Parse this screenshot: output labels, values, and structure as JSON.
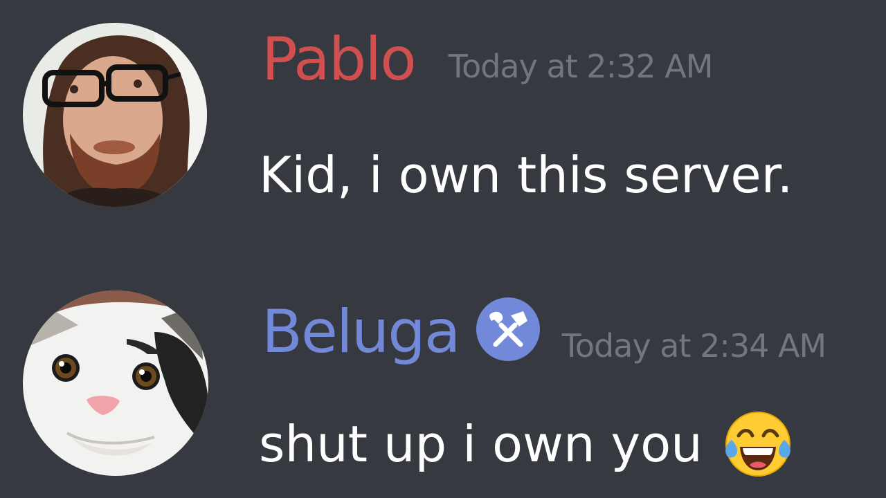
{
  "messages": [
    {
      "username": "Pablo",
      "timestamp": "Today at 2:32 AM",
      "text": "Kid, i own this server.",
      "username_color": "#d14f4f",
      "avatar": "man-with-glasses-avatar"
    },
    {
      "username": "Beluga",
      "timestamp": "Today at 2:34 AM",
      "text": "shut up i own you",
      "username_color": "#7289da",
      "avatar": "cat-avatar",
      "badge_icon": "hammer-wrench-icon",
      "emoji_icon": "tears-of-joy-emoji"
    }
  ],
  "theme": {
    "background": "#36393f",
    "timestamp_color": "#72767d",
    "text_color": "#ffffff"
  }
}
